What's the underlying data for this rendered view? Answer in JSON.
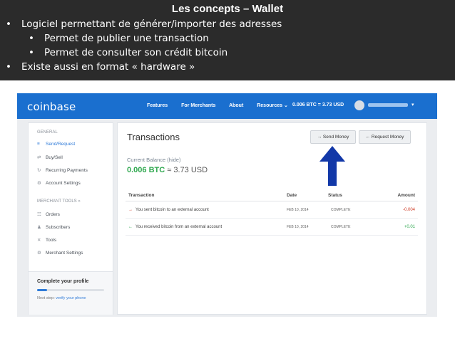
{
  "slide": {
    "title": "Les concepts – Wallet",
    "bullets": [
      {
        "marker": "•",
        "text": "Logiciel permettant de générer/importer des adresses"
      },
      {
        "marker": "•",
        "text": "Permet de publier une transaction"
      },
      {
        "marker": "•",
        "text": "Permet de consulter son crédit bitcoin"
      },
      {
        "marker": "•",
        "text": "Existe aussi en format « hardware »"
      }
    ]
  },
  "app": {
    "logo": "coinbase",
    "nav": {
      "features": "Features",
      "merchants": "For Merchants",
      "about": "About",
      "resources": "Resources ⌄",
      "balance": "0.006 BTC = 3.73 USD",
      "caret": "▾"
    },
    "sidebar": {
      "general_header": "GENERAL",
      "items": [
        {
          "label": "Send/Request",
          "icon": "≡"
        },
        {
          "label": "Buy/Sell",
          "icon": "⇄"
        },
        {
          "label": "Recurring Payments",
          "icon": "↻"
        },
        {
          "label": "Account Settings",
          "icon": "⚙"
        }
      ],
      "merchant_header": "MERCHANT TOOLS »",
      "merchant_items": [
        {
          "label": "Orders",
          "icon": "☷"
        },
        {
          "label": "Subscribers",
          "icon": "♟"
        },
        {
          "label": "Tools",
          "icon": "✕"
        },
        {
          "label": "Merchant Settings",
          "icon": "⚙"
        }
      ],
      "profile": {
        "title": "Complete your profile",
        "progress": 0.15,
        "next_step_prefix": "Next step:",
        "next_step_link": "verify your phone"
      }
    },
    "main": {
      "title": "Transactions",
      "send_button": "→ Send Money",
      "request_button": "← Request Money",
      "balance_label": "Current Balance (hide)",
      "balance_btc": "0.006 BTC",
      "balance_usd": "≈ 3.73 USD",
      "columns": {
        "transaction": "Transaction",
        "date": "Date",
        "status": "Status",
        "amount": "Amount"
      },
      "rows": [
        {
          "indicator": "→",
          "description": "You sent bitcoin to an external account",
          "date": "FEB 10, 2014",
          "status": "COMPLETE",
          "amount": "-0.004"
        },
        {
          "indicator": "←",
          "description": "You received bitcoin from an external account",
          "date": "FEB 10, 2014",
          "status": "COMPLETE",
          "amount": "+0.01"
        }
      ]
    }
  },
  "colors": {
    "header_bg": "#2b2b2b",
    "coinbase_blue": "#1a6fcf",
    "arrow_blue": "#1238a8",
    "positive": "#2fa84f",
    "negative": "#d0402b"
  }
}
